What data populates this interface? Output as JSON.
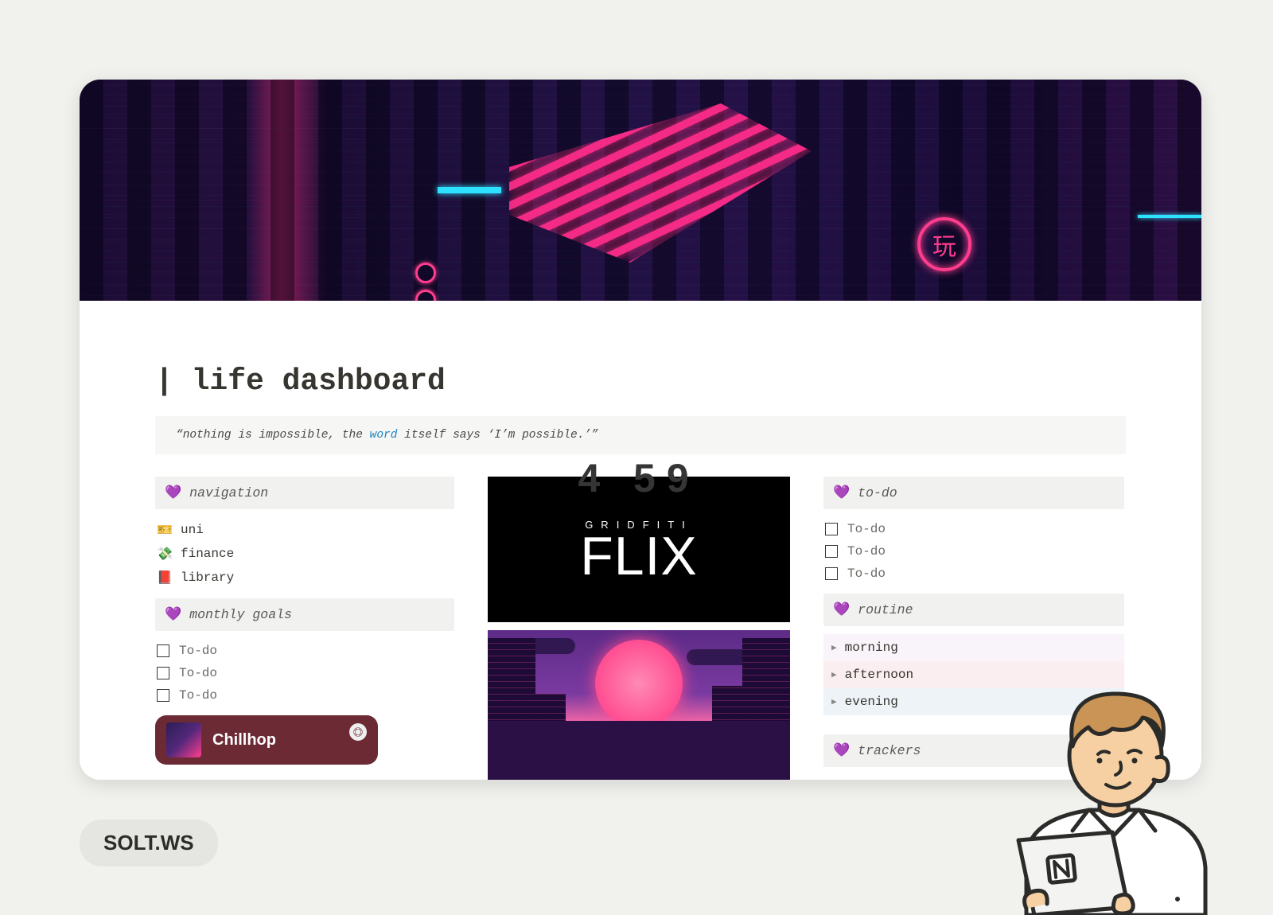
{
  "page": {
    "title": "| life dashboard",
    "icon_name": "retro-computer"
  },
  "quote": {
    "prefix": "“nothing is impossible, the ",
    "link_word": "word",
    "suffix": " itself says ‘I’m possible.’”"
  },
  "heart_emoji": "💜",
  "sections": {
    "navigation_label": "navigation",
    "monthly_goals_label": "monthly goals",
    "todo_label": "to-do",
    "routine_label": "routine",
    "trackers_label": "trackers"
  },
  "navigation": [
    {
      "emoji": "🎫",
      "label": "uni"
    },
    {
      "emoji": "💸",
      "label": "finance"
    },
    {
      "emoji": "📕",
      "label": "library"
    }
  ],
  "monthly_goals": [
    {
      "label": "To-do"
    },
    {
      "label": "To-do"
    },
    {
      "label": "To-do"
    }
  ],
  "todos": [
    {
      "label": "To-do"
    },
    {
      "label": "To-do"
    },
    {
      "label": "To-do"
    }
  ],
  "routine": [
    {
      "label": "morning",
      "tone": "morning"
    },
    {
      "label": "afternoon",
      "tone": "afternoon"
    },
    {
      "label": "evening",
      "tone": "evening"
    }
  ],
  "center_widgets": {
    "flix_subtitle": "GRIDFITI",
    "flix_title": "FLIX",
    "hidden_clock": "4 59"
  },
  "spotify": {
    "track_title": "Chillhop"
  },
  "badge_text": "SOLT.WS",
  "colors": {
    "page_bg": "#f1f1ee",
    "section_bg": "#f1f1ef",
    "accent_pink": "#ff2d78",
    "accent_cyan": "#2de1ff",
    "heart": "#a97cff",
    "link": "#1a84c4"
  }
}
